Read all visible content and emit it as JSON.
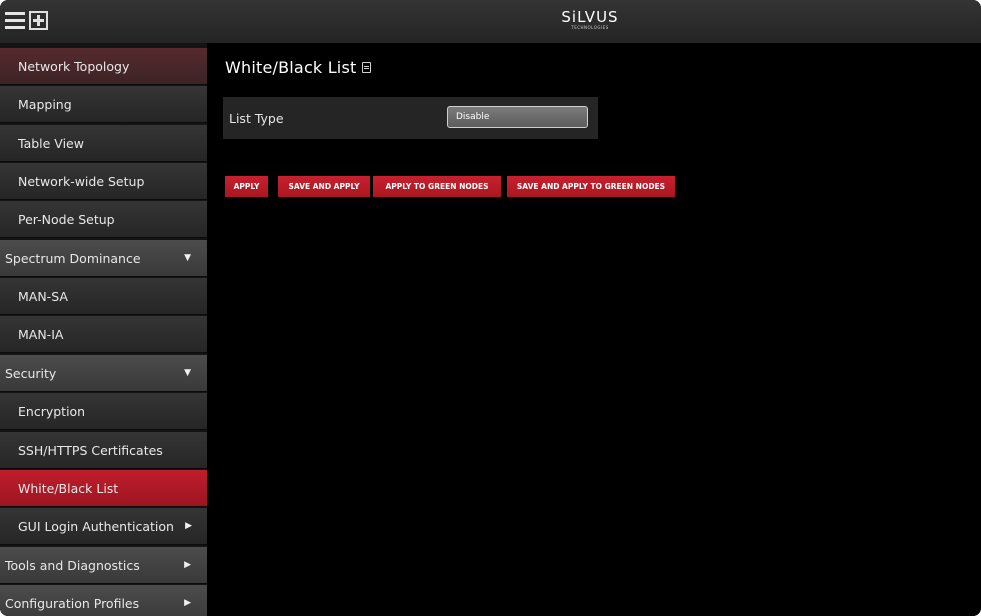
{
  "header": {
    "logo_main": "SiLVUS",
    "logo_sub": "TECHNOLOGIES",
    "menu_icon": "hamburger-menu-icon",
    "plus_icon": "add-square-icon"
  },
  "sidebar": {
    "items": [
      {
        "label": "Network Topology"
      },
      {
        "label": "Mapping"
      },
      {
        "label": "Table View"
      },
      {
        "label": "Network-wide Setup"
      },
      {
        "label": "Per-Node Setup"
      },
      {
        "label": "Spectrum Dominance"
      },
      {
        "label": "MAN-SA"
      },
      {
        "label": "MAN-IA"
      },
      {
        "label": "Security"
      },
      {
        "label": "Encryption"
      },
      {
        "label": "SSH/HTTPS Certificates"
      },
      {
        "label": "White/Black List"
      },
      {
        "label": "GUI Login Authentication"
      },
      {
        "label": "Tools and Diagnostics"
      },
      {
        "label": "Configuration Profiles"
      }
    ],
    "arrow_down": "▼",
    "arrow_right": "▶"
  },
  "main": {
    "title": "White/Black List",
    "list_type_label": "List Type",
    "list_type_value": "Disable",
    "buttons": {
      "apply": "APPLY",
      "save_apply": "SAVE AND APPLY",
      "apply_green": "APPLY TO GREEN NODES",
      "save_apply_green": "SAVE AND APPLY TO GREEN NODES"
    }
  },
  "colors": {
    "accent_red": "#b41b27",
    "background": "#000000",
    "sidebar_item": "#2e2e2e",
    "sidebar_group": "#434343"
  }
}
